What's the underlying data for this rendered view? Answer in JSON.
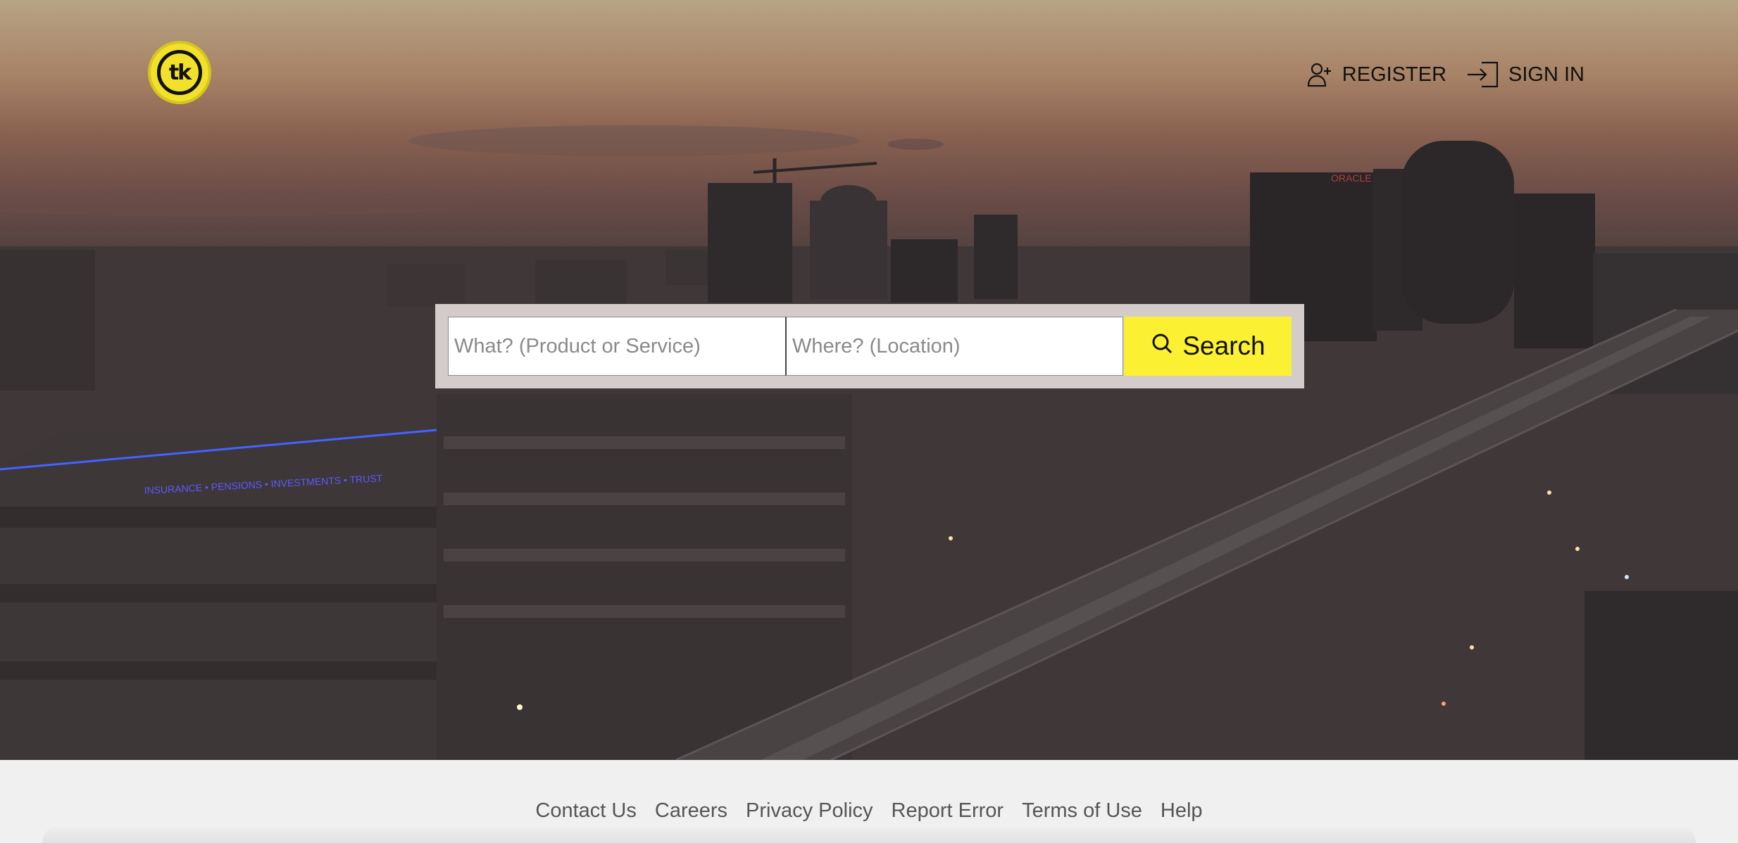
{
  "header": {
    "logo_text": "tk",
    "register_label": "REGISTER",
    "signin_label": "SIGN IN",
    "register_icon": "user-plus-icon",
    "signin_icon": "sign-in-icon"
  },
  "search": {
    "what_placeholder": "What? (Product or Service)",
    "where_placeholder": "Where? (Location)",
    "button_label": "Search",
    "button_icon": "search-icon"
  },
  "hero": {
    "building_sign": "INSURANCE  •  PENSIONS  •  INVESTMENTS  •  TRUST"
  },
  "footer": {
    "links": [
      "Contact Us",
      "Careers",
      "Privacy Policy",
      "Report Error",
      "Terms of Use",
      "Help"
    ]
  },
  "colors": {
    "accent": "#fbf031",
    "logo": "#f2e12a",
    "footer_bg": "#f0f0f0"
  }
}
